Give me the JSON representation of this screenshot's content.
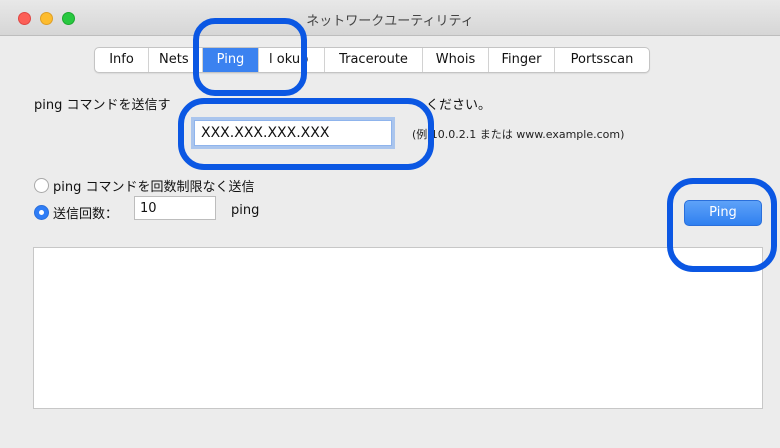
{
  "window": {
    "title": "ネットワークユーティリティ"
  },
  "tabs": [
    {
      "label": "Info"
    },
    {
      "label": "Nets  t"
    },
    {
      "label": "Ping"
    },
    {
      "label": "l  okup"
    },
    {
      "label": "Traceroute"
    },
    {
      "label": "Whois"
    },
    {
      "label": "Finger"
    },
    {
      "label": "Portsscan"
    }
  ],
  "active_tab": "Ping",
  "ping": {
    "instruction_visible": "ping コマンドを送信す",
    "instruction_tail": "ください。",
    "address_value": "XXX.XXX.XXX.XXX",
    "example_text": "(例  10.0.2.1 または www.example.com)",
    "option_unlimited": "ping コマンドを回数制限なく送信",
    "option_count": "送信回数：",
    "count_value": "10",
    "count_unit": "ping",
    "button_label": "Ping"
  },
  "colors": {
    "accent": "#3b82f0",
    "highlight": "#0b57e3"
  }
}
